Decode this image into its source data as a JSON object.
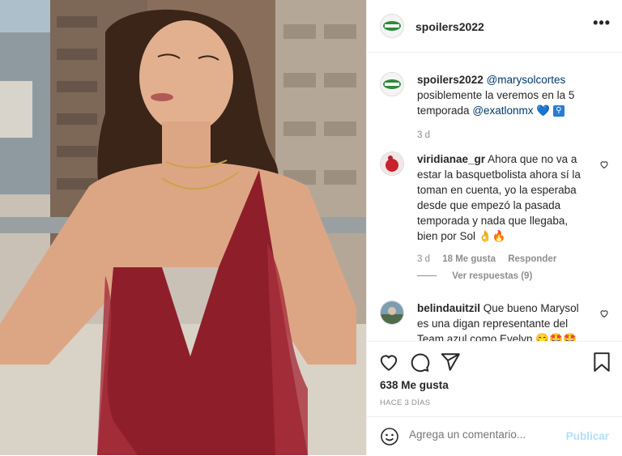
{
  "post": {
    "username": "spoilers2022",
    "more_icon": "•••",
    "caption": {
      "username": "spoilers2022",
      "mention1": "@marysolcortes",
      "text": "posiblemente la veremos en la 5 temporada",
      "mention2": "@exatlonmx",
      "emojis": "💙",
      "badge": "🚹",
      "time": "3 d"
    },
    "comments": [
      {
        "username": "viridianae_gr",
        "text": "Ahora que no va a estar la basquetbolista ahora sí la toman en cuenta, yo la esperaba desde que empezó la pasada temporada y nada que llegaba, bien por Sol",
        "emojis": "👌🔥",
        "time": "3 d",
        "likes": "18 Me gusta",
        "reply": "Responder",
        "view_replies": "Ver respuestas (9)"
      },
      {
        "username": "belindauitzil",
        "text": "Que bueno Marysol es una digan representante del Team azul como Evelyn",
        "emojis": "😋🤩🤩"
      }
    ],
    "likes": "638 Me gusta",
    "ago": "HACE 3 DÍAS",
    "add_comment_placeholder": "Agrega un comentario...",
    "publish": "Publicar"
  },
  "colors": {
    "accent_link": "#00376b",
    "publish_disabled": "#b2dffc",
    "dress": "#8e1f2a"
  }
}
